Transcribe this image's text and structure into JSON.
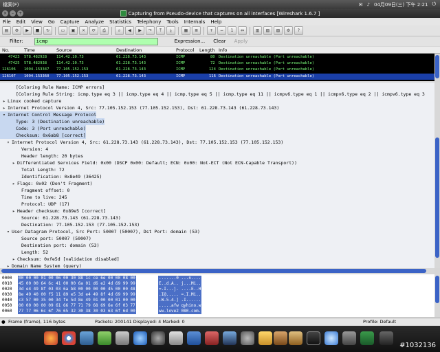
{
  "topbar": {
    "app_menu": "檔案(F)",
    "clock": "04月09日(三) 下午 2:21"
  },
  "window": {
    "title": "Capturing from Pseudo-device that captures on all interfaces   [Wireshark 1.6.7 ]"
  },
  "menu": [
    "File",
    "Edit",
    "View",
    "Go",
    "Capture",
    "Analyze",
    "Statistics",
    "Telephony",
    "Tools",
    "Internals",
    "Help"
  ],
  "filter": {
    "label": "Filter:",
    "value": "icmp",
    "expression": "Expression...",
    "clear": "Clear",
    "apply": "Apply"
  },
  "columns": [
    "No.",
    "Time",
    "Source",
    "Destination",
    "Protocol",
    "Length",
    "Info"
  ],
  "packets": [
    {
      "no": "47423",
      "time": "578.482928",
      "src": "114.42.10.73",
      "dst": "61.228.73.143",
      "proto": "ICMP",
      "len": "80",
      "info": "Destination unreachable (Port unreachable)"
    },
    {
      "no": "47425",
      "time": "578.482938",
      "src": "114.42.10.73",
      "dst": "61.228.73.143",
      "proto": "ICMP",
      "len": "72",
      "info": "Destination unreachable (Port unreachable)"
    },
    {
      "no": "126106",
      "time": "1094.153347",
      "src": "77.105.152.153",
      "dst": "61.228.73.143",
      "proto": "ICMP",
      "len": "124",
      "info": "Destination unreachable (Port unreachable)"
    },
    {
      "no": "126107",
      "time": "1094.153360",
      "src": "77.105.152.153",
      "dst": "61.228.73.143",
      "proto": "ICMP",
      "len": "116",
      "info": "Destination unreachable (Port unreachable)"
    }
  ],
  "details": [
    {
      "t": "",
      "x": "[Coloring Rule Name: ICMP errors]",
      "i": 16
    },
    {
      "t": "",
      "x": "[Coloring Rule String: icmp.type eq 3 || icmp.type eq 4 || icmp.type eq 5 || icmp.type eq 11 || icmpv6.type eq 1 || icmpv6.type eq 2 || icmpv6.type eq 3",
      "i": 16
    },
    {
      "t": "▸",
      "x": "Linux cooked capture",
      "i": 4
    },
    {
      "t": "▸",
      "x": "Internet Protocol Version 4, Src: 77.105.152.153 (77.105.152.153), Dst: 61.228.73.143 (61.228.73.143)",
      "i": 4
    },
    {
      "t": "▾",
      "x": "Internet Control Message Protocol",
      "i": 4
    },
    {
      "t": "",
      "x": "Type: 3 (Destination unreachable)",
      "i": 16
    },
    {
      "t": "",
      "x": "Code: 3 (Port unreachable)",
      "i": 16
    },
    {
      "t": "",
      "x": "Checksum: 0x6ab8 [correct]",
      "i": 16
    },
    {
      "t": "▾",
      "x": "Internet Protocol Version 4, Src: 61.228.73.143 (61.228.73.143), Dst: 77.105.152.153 (77.105.152.153)",
      "i": 10
    },
    {
      "t": "",
      "x": "Version: 4",
      "i": 24
    },
    {
      "t": "",
      "x": "Header length: 20 bytes",
      "i": 24
    },
    {
      "t": "▸",
      "x": "Differentiated Services Field: 0x00 (DSCP 0x00: Default; ECN: 0x00: Not-ECT (Not ECN-Capable Transport))",
      "i": 18
    },
    {
      "t": "",
      "x": "Total Length: 72",
      "i": 24
    },
    {
      "t": "",
      "x": "Identification: 0x8e49 (36425)",
      "i": 24
    },
    {
      "t": "▸",
      "x": "Flags: 0x02 (Don't Fragment)",
      "i": 18
    },
    {
      "t": "",
      "x": "Fragment offset: 0",
      "i": 24
    },
    {
      "t": "",
      "x": "Time to live: 245",
      "i": 24
    },
    {
      "t": "",
      "x": "Protocol: UDP (17)",
      "i": 24
    },
    {
      "t": "▸",
      "x": "Header checksum: 0x89e5 [correct]",
      "i": 18
    },
    {
      "t": "",
      "x": "Source: 61.228.73.143 (61.228.73.143)",
      "i": 24
    },
    {
      "t": "",
      "x": "Destination: 77.105.152.153 (77.105.152.153)",
      "i": 24
    },
    {
      "t": "▾",
      "x": "User Datagram Protocol, Src Port: 50007 (50007), Dst Port: domain (53)",
      "i": 10
    },
    {
      "t": "",
      "x": "Source port: 50007 (50007)",
      "i": 24
    },
    {
      "t": "",
      "x": "Destination port: domain (53)",
      "i": 24
    },
    {
      "t": "",
      "x": "Length: 52",
      "i": 24
    },
    {
      "t": "▸",
      "x": "Checksum: 0xfe5d [validation disabled]",
      "i": 18
    },
    {
      "t": "▸",
      "x": "Domain Name System (query)",
      "i": 10
    }
  ],
  "hex": [
    {
      "off": "0000",
      "hex": "00 00 00 01 00 06 00 30  88 1c ce 6e 00 00 08 00",
      "asc": ".......0 ...n...."
    },
    {
      "off": "0010",
      "hex": "45 00 00 64 6c 41 00 00  6a 01 d6 e2 4d 69 99 99",
      "asc": "E..d.A.. j...Mi.."
    },
    {
      "off": "0020",
      "hex": "3d e4 49 8f 03 03 6a b8  00 00 00 00 45 00 00 48",
      "asc": "=.I...j. ....E..H"
    },
    {
      "off": "0030",
      "hex": "8e 49 40 00 f5 11 89 e5  3d e4 49 8f 4d 69 99 99",
      "asc": ".I@..... =.I.Mi.."
    },
    {
      "off": "0040",
      "hex": "c3 57 00 35 00 34 fe 5d  8e 49 01 00 00 01 00 00",
      "asc": ".W.5.4.] .I......"
    },
    {
      "off": "0050",
      "hex": "00 00 00 00 09 61 66 77  71 79 68 69 6e 6f 03 77",
      "asc": ".....afw qyhino.w"
    },
    {
      "off": "0060",
      "hex": "77 77 06 6c 6f 76 65 32  30 38 30 03 63 6f 6d 00",
      "asc": "ww.love2 080.com."
    }
  ],
  "status": {
    "frame": "Frame (frame), 116 bytes",
    "packets": "Packets: 200141 Displayed: 4 Marked: 0",
    "profile": "Profile: Default"
  },
  "watermark": "#1032136"
}
